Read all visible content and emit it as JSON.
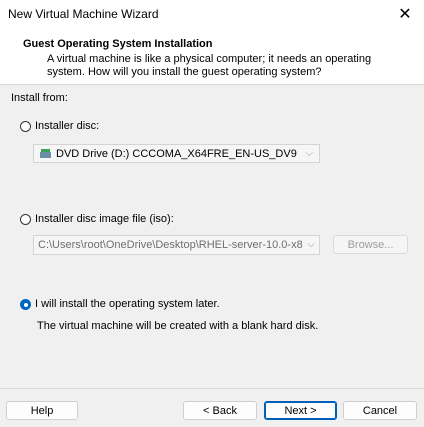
{
  "window": {
    "title": "New Virtual Machine Wizard",
    "close_icon": "close-icon"
  },
  "header": {
    "title": "Guest Operating System Installation",
    "description": "A virtual machine is like a physical computer; it needs an operating system. How will you install the guest operating system?"
  },
  "install_from": {
    "label": "Install from:",
    "installer_disc": {
      "label": "Installer disc:",
      "selected": false,
      "drive_value": "DVD Drive (D:) CCCOMA_X64FRE_EN-US_DV9"
    },
    "iso": {
      "label": "Installer disc image file (iso):",
      "selected": false,
      "path_value": "C:\\Users\\root\\OneDrive\\Desktop\\RHEL-server-10.0-x8",
      "browse_label": "Browse..."
    },
    "later": {
      "label": "I will install the operating system later.",
      "selected": true,
      "note": "The virtual machine will be created with a blank hard disk."
    }
  },
  "buttons": {
    "help": "Help",
    "back": "< Back",
    "next": "Next >",
    "cancel": "Cancel"
  },
  "colors": {
    "accent": "#0067c0",
    "background": "#f0f0f0",
    "header_bg": "#ffffff"
  }
}
